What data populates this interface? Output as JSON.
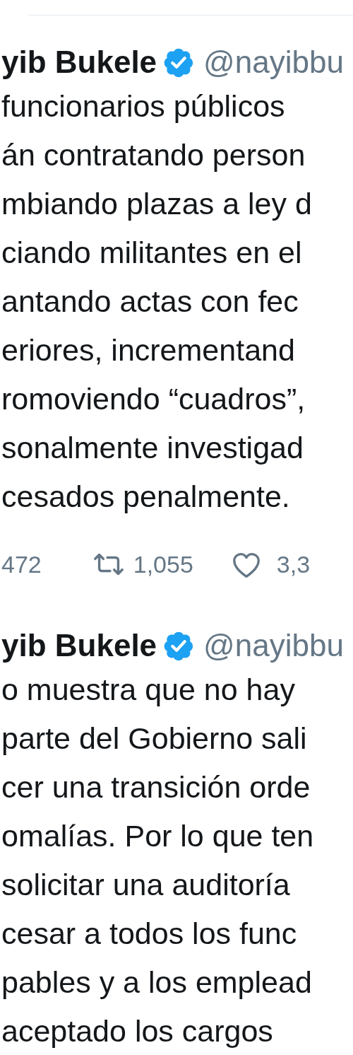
{
  "tweets": [
    {
      "name": "yib Bukele",
      "verified": true,
      "handle": "@nayibbu",
      "lines": [
        "funcionarios públicos",
        "án contratando person",
        "mbiando plazas a ley d",
        "ciando militantes en el",
        "antando actas con fec",
        "eriores, incrementand",
        "romoviendo “cuadros”,",
        "sonalmente investigad",
        "cesados penalmente."
      ],
      "actions": {
        "replies": "472",
        "retweets": "1,055",
        "likes": "3,3"
      }
    },
    {
      "name": "yib Bukele",
      "verified": true,
      "handle": "@nayibbu",
      "lines": [
        "o muestra que no hay",
        "parte del Gobierno sali",
        "cer una transición orde",
        "omalías. Por lo que ten",
        "solicitar una auditoría",
        "cesar a todos los func",
        "pables y a los emplead",
        "aceptado los cargos"
      ]
    }
  ]
}
